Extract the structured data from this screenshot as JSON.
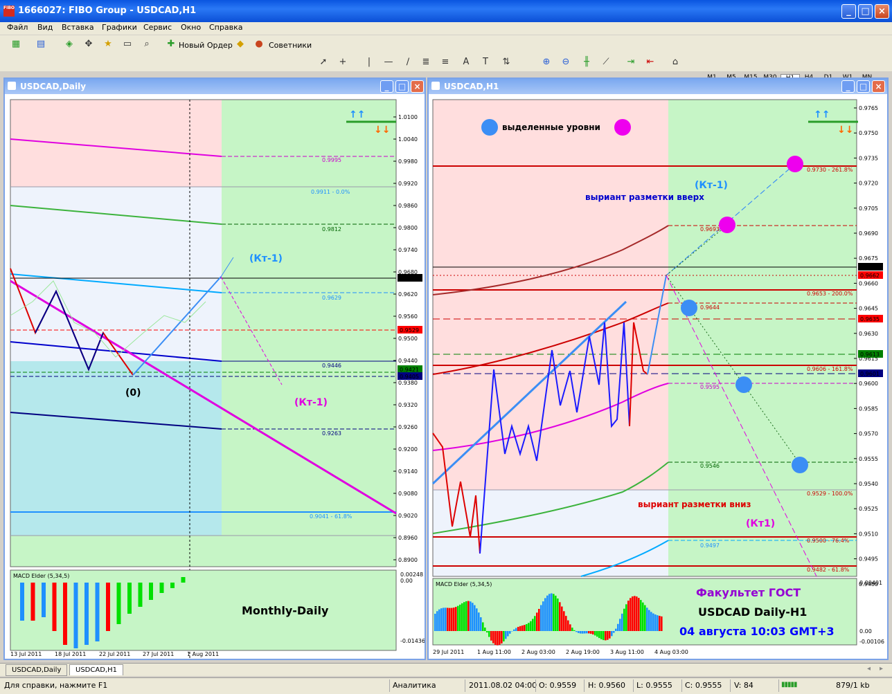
{
  "app": {
    "title": "1666027: FIBO Group - USDCAD,H1",
    "icon_text": "FIBO"
  },
  "menu": [
    "Файл",
    "Вид",
    "Вставка",
    "Графики",
    "Сервис",
    "Окно",
    "Справка"
  ],
  "toolbar": {
    "new_order": "Новый Ордер",
    "advisors": "Советники"
  },
  "timeframes": [
    "M1",
    "M5",
    "M15",
    "M30",
    "H1",
    "H4",
    "D1",
    "W1",
    "MN"
  ],
  "active_timeframe": "H1",
  "left": {
    "title": "USDCAD,Daily",
    "y_ticks": [
      "1.0100",
      "1.0040",
      "0.9980",
      "0.9920",
      "0.9860",
      "0.9800",
      "0.9740",
      "0.9680",
      "0.9620",
      "0.9560",
      "0.9500",
      "0.9440",
      "0.9380",
      "0.9320",
      "0.9260",
      "0.9200",
      "0.9140",
      "0.9080",
      "0.9020",
      "0.8960",
      "0.8900"
    ],
    "price_labels": [
      {
        "text": "0.9667",
        "bg": "#000000"
      },
      {
        "text": "0.9529",
        "bg": "#ff0000"
      },
      {
        "text": "0.9421",
        "bg": "#008000"
      },
      {
        "text": "0.9405",
        "bg": "#000080"
      }
    ],
    "levels": [
      {
        "text": "0.9995",
        "color": "#cc00cc"
      },
      {
        "text": "0.9911 - 0.0%",
        "color": "#1e90ff"
      },
      {
        "text": "0.9812",
        "color": "#006400"
      },
      {
        "text": "0.9629",
        "color": "#1e90ff"
      },
      {
        "text": "0.9446",
        "color": "#000080"
      },
      {
        "text": "0.9263",
        "color": "#000080"
      },
      {
        "text": "0.9041 - 61.8%",
        "color": "#1e90ff"
      }
    ],
    "annotations": {
      "kt1_blue": "(Кт-1)",
      "kt1_magenta": "(Кт-1)",
      "zero": "(0)",
      "monthly_daily": "Monthly-Daily"
    },
    "macd": {
      "label": "MACD Elder (5,34,5)",
      "ticks": [
        "0.00248",
        "0.00",
        "-0.01436"
      ]
    },
    "x_ticks": [
      "13 Jul 2011",
      "18 Jul 2011",
      "22 Jul 2011",
      "27 Jul 2011",
      "1 Aug 2011"
    ]
  },
  "right": {
    "title": "USDCAD,H1",
    "y_ticks": [
      "0.9765",
      "0.9750",
      "0.9735",
      "0.9720",
      "0.9705",
      "0.9690",
      "0.9675",
      "0.9660",
      "0.9645",
      "0.9630",
      "0.9615",
      "0.9600",
      "0.9585",
      "0.9570",
      "0.9555",
      "0.9540",
      "0.9525",
      "0.9510",
      "0.9495",
      "0.9480"
    ],
    "price_labels": [
      {
        "text": "0.9667",
        "bg": "#000000"
      },
      {
        "text": "0.9662",
        "bg": "#ff0000"
      },
      {
        "text": "0.9635",
        "bg": "#ff0000"
      },
      {
        "text": "0.9613",
        "bg": "#008000"
      },
      {
        "text": "0.9601",
        "bg": "#000080"
      }
    ],
    "levels": [
      {
        "text": "0.9730 - 261.8%",
        "color": "#cc0000"
      },
      {
        "text": "0.9693",
        "color": "#cc0000"
      },
      {
        "text": "0.9653 - 200.0%",
        "color": "#cc0000"
      },
      {
        "text": "0.9644",
        "color": "#cc0000"
      },
      {
        "text": "0.9606 - 161.8%",
        "color": "#cc0000"
      },
      {
        "text": "0.9595",
        "color": "#cc00cc"
      },
      {
        "text": "0.9546",
        "color": "#006400"
      },
      {
        "text": "0.9529 - 100.0%",
        "color": "#cc0000"
      },
      {
        "text": "0.9500 - 76.4%",
        "color": "#cc0000"
      },
      {
        "text": "0.9497",
        "color": "#1e90ff"
      },
      {
        "text": "0.9482 - 61.8%",
        "color": "#cc0000"
      }
    ],
    "annotations": {
      "legend": "выделенные уровни",
      "kt1_blue": "(Кт-1)",
      "up_variant": "выриант разметки вверх",
      "down_variant": "выриант разметки вниз",
      "kt1_magenta": "(Кт1)",
      "faculty": "Факультет ГОСТ",
      "pair": "USDCAD Daily-H1",
      "date": "04 августа 10:03 GMT+3"
    },
    "macd": {
      "label": "MACD Elder (5,34,5)",
      "ticks": [
        "0.00401",
        "0.00",
        "-0.00106"
      ]
    },
    "x_ticks": [
      "29 Jul 2011",
      "1 Aug 11:00",
      "2 Aug 03:00",
      "2 Aug 19:00",
      "3 Aug 11:00",
      "4 Aug 03:00"
    ]
  },
  "tabs": [
    "USDCAD,Daily",
    "USDCAD,H1"
  ],
  "active_tab": "USDCAD,H1",
  "status": {
    "help": "Для справки, нажмите F1",
    "profile": "Аналитика",
    "time": "2011.08.02 04:00",
    "open": "O: 0.9559",
    "high": "H: 0.9560",
    "low": "L: 0.9555",
    "close": "C: 0.9555",
    "volume": "V: 84",
    "traffic": "879/1 kb"
  }
}
